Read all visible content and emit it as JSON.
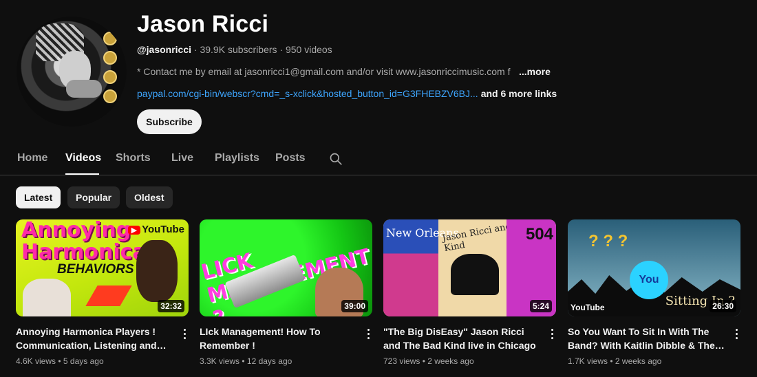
{
  "channel": {
    "name": "Jason Ricci",
    "handle": "@jasonricci",
    "stats": " · 39.9K subscribers · 950 videos",
    "description": "* Contact me by email at jasonricci1@gmail.com and/or visit www.jasonriccimusic.com f",
    "more_label": "...more",
    "link_url": "paypal.com/cgi-bin/webscr?cmd=_s-xclick&hosted_button_id=G3FHEBZV6BJ...",
    "more_links": "and 6 more links",
    "subscribe_label": "Subscribe"
  },
  "tabs": [
    {
      "label": "Home"
    },
    {
      "label": "Videos"
    },
    {
      "label": "Shorts"
    },
    {
      "label": "Live"
    },
    {
      "label": "Playlists"
    },
    {
      "label": "Posts"
    }
  ],
  "active_tab": "Videos",
  "chips": [
    {
      "label": "Latest"
    },
    {
      "label": "Popular"
    },
    {
      "label": "Oldest"
    }
  ],
  "selected_chip": "Latest",
  "videos": [
    {
      "title": "Annoying Harmonica Players ! Communication, Listening and Mo...",
      "views": "4.6K views",
      "age": "5 days ago",
      "duration": "32:32",
      "thumb_text": {
        "line1": "Annoying",
        "line2": "Harmonica",
        "line3": "BEHAVIORS",
        "brand": "YouTube",
        "brand_badge": "▶"
      }
    },
    {
      "title": "LIck Management! How To Remember !",
      "views": "3.3K views",
      "age": "12 days ago",
      "duration": "39:00",
      "thumb_text": {
        "line1": "LICK MANAGEMENT ?"
      }
    },
    {
      "title": "\"The Big DisEasy\" Jason Ricci and The Bad Kind live in Chicago",
      "views": "723 views",
      "age": "2 weeks ago",
      "duration": "5:24",
      "thumb_text": {
        "line1": "New Orleans",
        "line2": "Jason Ricci and The Bad Kind",
        "line3": "504"
      }
    },
    {
      "title": "So You Want To Sit In With The Band? With Kaitlin Dibble & The Ba...",
      "views": "1.7K views",
      "age": "2 weeks ago",
      "duration": "26:30",
      "thumb_text": {
        "line1": "You",
        "line2": "Sitting In ?",
        "brand": "YouTube",
        "q": "? ? ?"
      }
    }
  ],
  "colors": {
    "background": "#0f0f0f",
    "link": "#3ea6ff",
    "chip_selected_bg": "#f1f1f1",
    "chip_bg": "#272727"
  }
}
